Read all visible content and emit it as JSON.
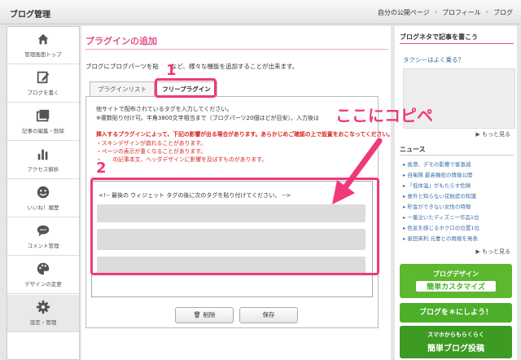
{
  "topbar": {
    "title": "ブログ管理",
    "links": [
      "自分の公開ページ",
      "プロフィール",
      "ブログ"
    ]
  },
  "sidebar": {
    "items": [
      {
        "label": "管理画面トップ",
        "icon": "home-icon"
      },
      {
        "label": "ブログを書く",
        "icon": "pencil-icon"
      },
      {
        "label": "記事の編集・削除",
        "icon": "folder-icon"
      },
      {
        "label": "アクセス解析",
        "icon": "bar-chart-icon"
      },
      {
        "label": "いいね！履歴",
        "icon": "smile-icon"
      },
      {
        "label": "コメント管理",
        "icon": "comment-icon"
      },
      {
        "label": "デザインの変更",
        "icon": "palette-icon"
      },
      {
        "label": "設定・管理",
        "icon": "gear-icon"
      }
    ]
  },
  "main": {
    "title": "プラグインの追加",
    "description": "ブログにブログパーツを貼　　など、様々な機能を追加することが出来ます。",
    "tabs": [
      "プラグインリスト",
      "フリープラグイン"
    ],
    "info_lines": [
      "他サイトで配布されているタグを入力してください。",
      "※複数貼り付け可。半角3800文字相当まで（ブログパーツ20個ほどが目安）。入力後は　　　"
    ],
    "warning_lines": [
      "挿入するプラグインによって、下記の影響が出る場合があります。あらかじめご確認の上で設置をおこなってください。",
      "・スキンデザインが崩れることがあります。",
      "・ページの表示が重くなることがあります。",
      "・　　の記事本文、ヘッダデザインに影響を及ぼすものがあります。"
    ],
    "textarea_first_line": "<!-- 最後の ウィジェット タグの後に次のタグを貼り付けてください。 -->",
    "buttons": {
      "delete": "削除",
      "save": "保存"
    }
  },
  "right": {
    "topic_heading": "ブログネタで記事を書こう",
    "topic_link": "タクシーはよく乗る？",
    "more": "もっと見る",
    "news_heading": "ニュース",
    "news": [
      "香港、デモの影響で客激減",
      "自衛隊 最高機密の情報公開",
      "「低体温」がもたらす危険",
      "意外と知らない花粉症の知識",
      "貯金ができない女性の特徴",
      "一番泣いたディズニー作品1位",
      "色気を感じるホクロの位置1位",
      "星田英利 元妻との再婚を発表"
    ],
    "banners": [
      {
        "line1": "ブログデザイン",
        "line2": "簡単カスタマイズ"
      },
      {
        "line1": "ブログを＊にしよう！"
      },
      {
        "line1": "スマホからもらくらく",
        "line2": "簡単ブログ投稿"
      }
    ]
  },
  "annotations": {
    "num1": "1",
    "num2": "2",
    "copy_here": "ここにコピペ"
  },
  "colors": {
    "accent_pink": "#e0508a",
    "annotation_pink": "#f0397a",
    "warning_red": "#d8261f",
    "banner_green": "#4caf2a"
  }
}
